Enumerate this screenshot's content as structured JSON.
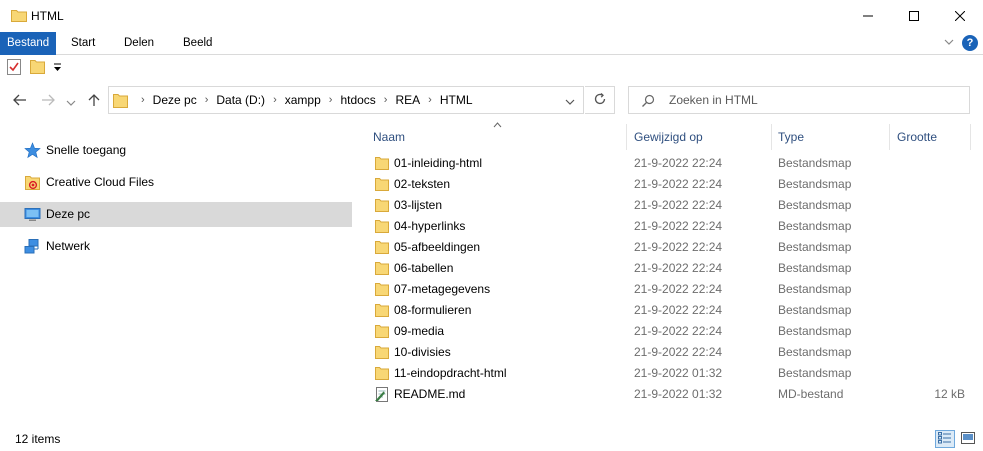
{
  "window": {
    "title": "HTML"
  },
  "ribbon": {
    "tabs": [
      "Bestand",
      "Start",
      "Delen",
      "Beeld"
    ],
    "help": "?"
  },
  "address": {
    "crumbs": [
      "Deze pc",
      "Data (D:)",
      "xampp",
      "htdocs",
      "REA",
      "HTML"
    ]
  },
  "search": {
    "placeholder": "Zoeken in HTML"
  },
  "sidebar": {
    "items": [
      {
        "label": "Snelle toegang",
        "icon": "star-icon"
      },
      {
        "label": "Creative Cloud Files",
        "icon": "creative-cloud-folder-icon"
      },
      {
        "label": "Deze pc",
        "icon": "computer-icon"
      },
      {
        "label": "Netwerk",
        "icon": "network-icon"
      }
    ]
  },
  "columns": [
    "Naam",
    "Gewijzigd op",
    "Type",
    "Grootte"
  ],
  "files": [
    {
      "name": "01-inleiding-html",
      "date": "21-9-2022 22:24",
      "type": "Bestandsmap",
      "size": ""
    },
    {
      "name": "02-teksten",
      "date": "21-9-2022 22:24",
      "type": "Bestandsmap",
      "size": ""
    },
    {
      "name": "03-lijsten",
      "date": "21-9-2022 22:24",
      "type": "Bestandsmap",
      "size": ""
    },
    {
      "name": "04-hyperlinks",
      "date": "21-9-2022 22:24",
      "type": "Bestandsmap",
      "size": ""
    },
    {
      "name": "05-afbeeldingen",
      "date": "21-9-2022 22:24",
      "type": "Bestandsmap",
      "size": ""
    },
    {
      "name": "06-tabellen",
      "date": "21-9-2022 22:24",
      "type": "Bestandsmap",
      "size": ""
    },
    {
      "name": "07-metagegevens",
      "date": "21-9-2022 22:24",
      "type": "Bestandsmap",
      "size": ""
    },
    {
      "name": "08-formulieren",
      "date": "21-9-2022 22:24",
      "type": "Bestandsmap",
      "size": ""
    },
    {
      "name": "09-media",
      "date": "21-9-2022 22:24",
      "type": "Bestandsmap",
      "size": ""
    },
    {
      "name": "10-divisies",
      "date": "21-9-2022 22:24",
      "type": "Bestandsmap",
      "size": ""
    },
    {
      "name": "11-eindopdracht-html",
      "date": "21-9-2022 01:32",
      "type": "Bestandsmap",
      "size": ""
    },
    {
      "name": "README.md",
      "date": "21-9-2022 01:32",
      "type": "MD-bestand",
      "size": "12 kB"
    }
  ],
  "status": {
    "count": "12 items"
  },
  "colors": {
    "accent": "#1a63b8",
    "folder": "#f8d775",
    "selected": "#d9d9d9"
  }
}
